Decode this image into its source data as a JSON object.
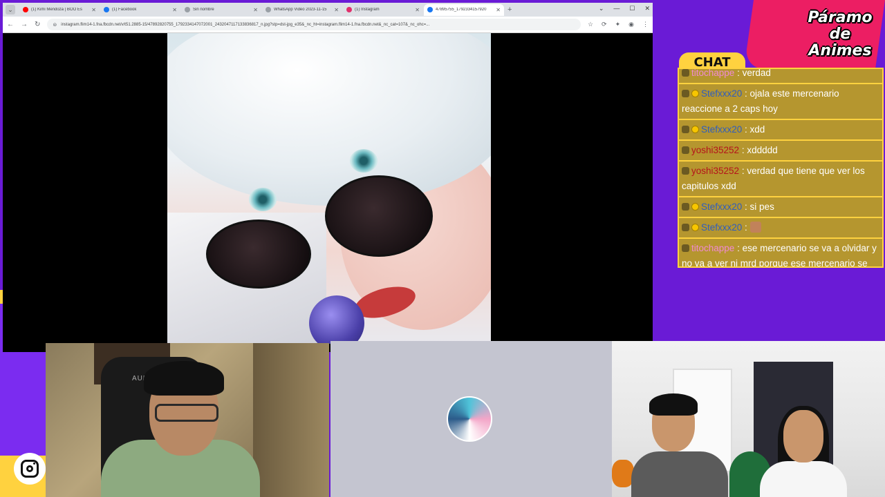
{
  "browser": {
    "tabs": [
      {
        "title": "(1) Kimi Mendoza | BOO Es",
        "fav": "#ff0000",
        "active": false
      },
      {
        "title": "(1) Facebook",
        "fav": "#1877f2",
        "active": false
      },
      {
        "title": "Sin nombre",
        "fav": "#9aa0a6",
        "active": false
      },
      {
        "title": "WhatsApp Video 2023-11-15",
        "fav": "#9aa0a6",
        "active": false
      },
      {
        "title": "(1) Instagram",
        "fav": "#e1306c",
        "active": false
      },
      {
        "title": "47895755_1792334157920",
        "fav": "#1877f2",
        "active": true
      }
    ],
    "new_tab": "+",
    "menu_icon": "⌄",
    "url": "instagram.flim14-1.fna.fbcdn.net/v/t51.2885-15/47892820755_1792334147072001_2432047117133836817_n.jpg?stp=dst-jpg_e35&_nc_ht=instagram.flim14-1.fna.fbcdn.net&_nc_cat=107&_nc_ohc=...",
    "window_controls": [
      "⌄",
      "—",
      "☐",
      "✕"
    ]
  },
  "chat": {
    "title": "CHAT",
    "messages": [
      {
        "user": "titochappe",
        "text": ": verdad",
        "color": "#f08bd2",
        "coin": false,
        "emote": false
      },
      {
        "user": "Stefxxx20",
        "text": ": ojala este mercenario reaccione a 2 caps hoy",
        "color": "#2f5dbf",
        "coin": true,
        "emote": false
      },
      {
        "user": "Stefxxx20",
        "text": ": xdd",
        "color": "#2f5dbf",
        "coin": true,
        "emote": false
      },
      {
        "user": "yoshi35252",
        "text": ": xddddd",
        "color": "#b5121b",
        "coin": false,
        "emote": false
      },
      {
        "user": "yoshi35252",
        "text": ": verdad que tiene que ver los capitulos xdd",
        "color": "#b5121b",
        "coin": false,
        "emote": false
      },
      {
        "user": "Stefxxx20",
        "text": ": si pes",
        "color": "#2f5dbf",
        "coin": true,
        "emote": false
      },
      {
        "user": "Stefxxx20",
        "text": ":",
        "color": "#2f5dbf",
        "coin": true,
        "emote": true
      },
      {
        "user": "titochappe",
        "text": ": ese mercenario se va a olvidar y no va a ver ni mrd porque ese mercenario se queda dormido",
        "color": "#f08bd2",
        "coin": false,
        "emote": false
      }
    ]
  },
  "logo": {
    "line1": "Páramo",
    "line2": "de",
    "line3": "Animes"
  },
  "cam1": {
    "chair_brand": "AUDAR"
  },
  "colors": {
    "background": "#6a1bd6",
    "chat_yellow": "#ffd23f",
    "logo_pink": "#ec1e63"
  }
}
